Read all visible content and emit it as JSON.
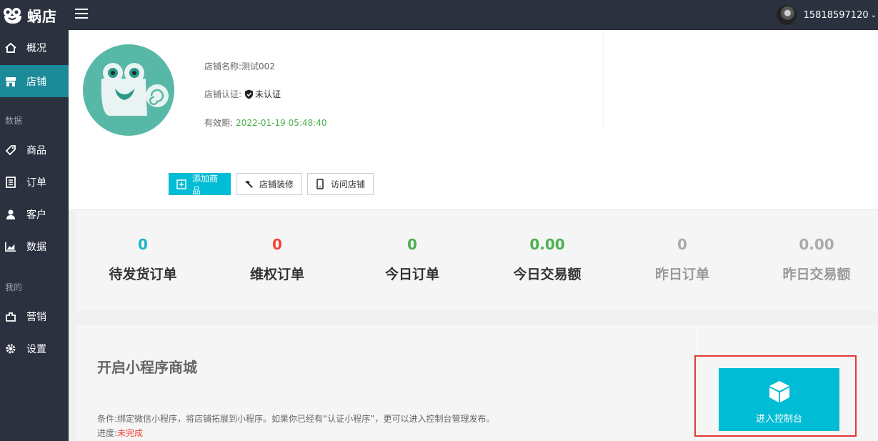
{
  "app": {
    "name": "蜗店"
  },
  "header": {
    "username": "15818597120"
  },
  "sidebar": {
    "items": [
      {
        "label": "概况"
      },
      {
        "label": "店铺"
      },
      {
        "label": "商品"
      },
      {
        "label": "订单"
      },
      {
        "label": "客户"
      },
      {
        "label": "数据"
      },
      {
        "label": "营销"
      },
      {
        "label": "设置"
      }
    ],
    "sections": [
      "数据",
      "我的"
    ]
  },
  "store": {
    "name_label": "店铺名称:",
    "name_value": "测试002",
    "cert_label": "店铺认证:",
    "cert_value": "未认证",
    "expire_label": "有效期:",
    "expire_value": "2022-01-19 05:48:40"
  },
  "actions": {
    "add_product": "添加商品",
    "decorate": "店铺装修",
    "visit": "访问店铺"
  },
  "stats": [
    {
      "value": "0",
      "label": "待发货订单",
      "color": "#1ab4c9"
    },
    {
      "value": "0",
      "label": "维权订单",
      "color": "#f44336"
    },
    {
      "value": "0",
      "label": "今日订单",
      "color": "#4caf50"
    },
    {
      "value": "0.00",
      "label": "今日交易额",
      "color": "#4caf50"
    },
    {
      "value": "0",
      "label": "昨日订单",
      "color": "#aaaaaa"
    },
    {
      "value": "0.00",
      "label": "昨日交易额",
      "color": "#aaaaaa"
    }
  ],
  "miniprogram": {
    "title": "开启小程序商城",
    "condition": "条件:绑定微信小程序，将店铺拓展到小程序。如果你已经有“认证小程序”，更可以进入控制台管理发布。",
    "progress_label": "进度:",
    "progress_value": "未完成",
    "console_button": "进入控制台"
  },
  "colors": {
    "sidebar_bg": "#2b313f",
    "active_item": "#1b8a99",
    "primary": "#00bcd4",
    "highlight_border": "#e53935"
  }
}
